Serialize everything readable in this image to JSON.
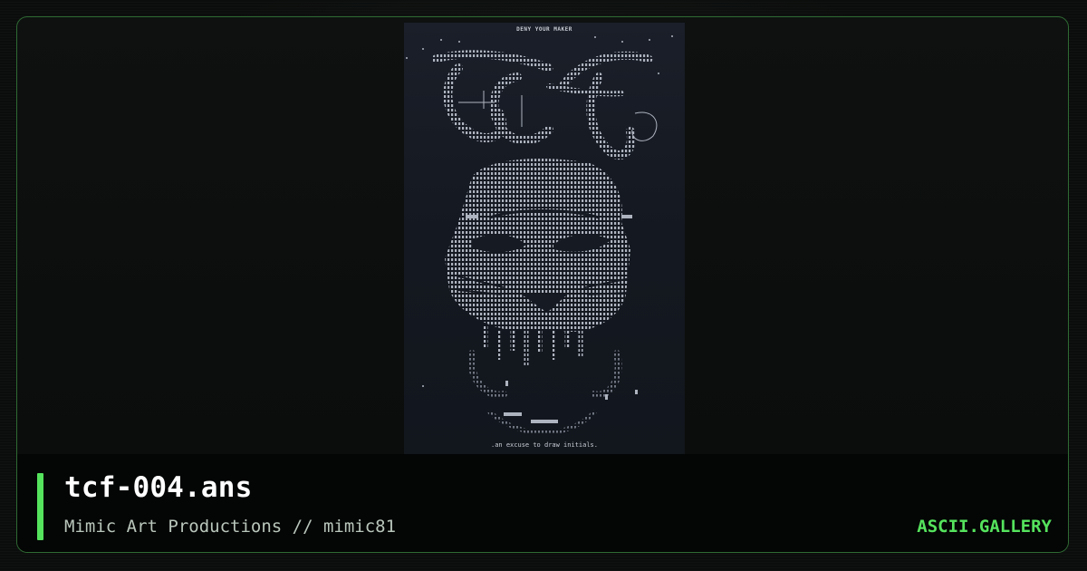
{
  "artwork": {
    "heading": "DENY YOUR MAKER",
    "caption": ".an excuse to draw initials."
  },
  "card": {
    "title": "tcf-004.ans",
    "subtitle": "Mimic Art Productions // mimic81",
    "brand": "ASCII.GALLERY"
  },
  "colors": {
    "accent": "#55e35d",
    "frame_border": "#2f6a33",
    "art_background": "#161b23",
    "art_ink": "#c8ccd4"
  }
}
